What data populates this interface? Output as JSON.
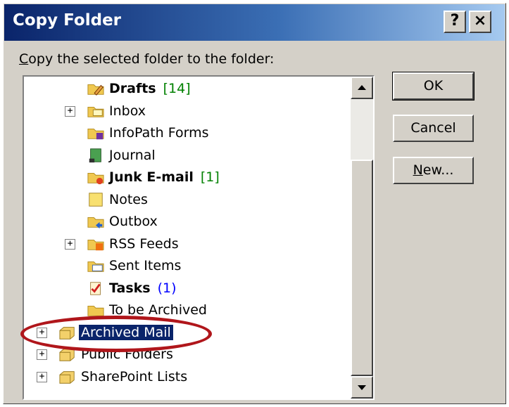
{
  "window": {
    "title": "Copy Folder",
    "help_label": "?",
    "close_label": "×"
  },
  "prompt": {
    "mnemonic": "C",
    "rest": "opy the selected folder to the folder:"
  },
  "tree": {
    "items": [
      {
        "name": "Drafts",
        "count": "[14]",
        "bold": true,
        "count_color": "green",
        "icon": "drafts-folder-icon",
        "expander": false,
        "indent": 1
      },
      {
        "name": "Inbox",
        "count": "",
        "bold": false,
        "icon": "inbox-folder-icon",
        "expander": true,
        "indent": 1
      },
      {
        "name": "InfoPath Forms",
        "count": "",
        "bold": false,
        "icon": "infopath-folder-icon",
        "expander": false,
        "indent": 1
      },
      {
        "name": "Journal",
        "count": "",
        "bold": false,
        "icon": "journal-icon",
        "expander": false,
        "indent": 1
      },
      {
        "name": "Junk E-mail",
        "count": "[1]",
        "bold": true,
        "count_color": "green",
        "icon": "junk-folder-icon",
        "expander": false,
        "indent": 1
      },
      {
        "name": "Notes",
        "count": "",
        "bold": false,
        "icon": "notes-icon",
        "expander": false,
        "indent": 1
      },
      {
        "name": "Outbox",
        "count": "",
        "bold": false,
        "icon": "outbox-folder-icon",
        "expander": false,
        "indent": 1
      },
      {
        "name": "RSS Feeds",
        "count": "",
        "bold": false,
        "icon": "rss-folder-icon",
        "expander": true,
        "indent": 1
      },
      {
        "name": "Sent Items",
        "count": "",
        "bold": false,
        "icon": "sent-folder-icon",
        "expander": false,
        "indent": 1
      },
      {
        "name": "Tasks",
        "count": "(1)",
        "bold": true,
        "count_color": "blue",
        "icon": "tasks-icon",
        "expander": false,
        "indent": 1
      },
      {
        "name": "To be Archived",
        "count": "",
        "bold": false,
        "icon": "folder-icon",
        "expander": false,
        "indent": 1
      },
      {
        "name": "Archived Mail",
        "count": "",
        "bold": false,
        "icon": "mailbox-icon",
        "expander": true,
        "indent": 0,
        "selected": true
      },
      {
        "name": "Public Folders",
        "count": "",
        "bold": false,
        "icon": "mailbox-icon",
        "expander": true,
        "indent": 0
      },
      {
        "name": "SharePoint Lists",
        "count": "",
        "bold": false,
        "icon": "mailbox-icon",
        "expander": true,
        "indent": 0
      }
    ]
  },
  "buttons": {
    "ok": "OK",
    "cancel": "Cancel",
    "new_mnemonic": "N",
    "new_rest": "ew..."
  },
  "colors": {
    "selection": "#0a246a",
    "annotation": "#b0161b",
    "count_green": "#008000",
    "count_blue": "#0000ff"
  }
}
